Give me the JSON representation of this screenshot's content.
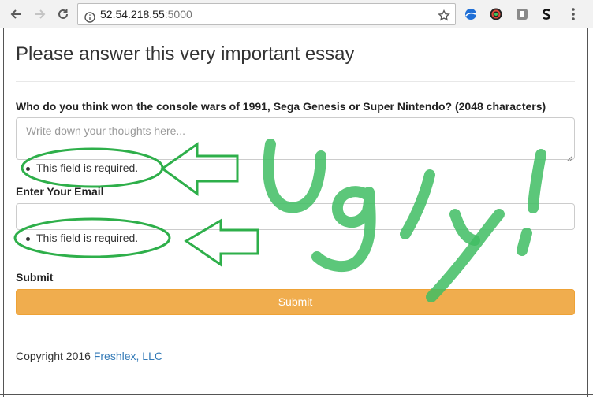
{
  "browser": {
    "url_host": "52.54.218.55",
    "url_port": ":5000",
    "icons": [
      "back-arrow-icon",
      "forward-arrow-icon",
      "reload-icon",
      "info-icon",
      "star-icon",
      "extension-icon",
      "extension-icon",
      "extension-icon",
      "extension-icon"
    ]
  },
  "page": {
    "title": "Please answer this very important essay",
    "question_label": "Who do you think won the console wars of 1991, Sega Genesis or Super Nintendo? (2048 characters)",
    "essay_placeholder": "Write down your thoughts here...",
    "essay_error": "This field is required.",
    "email_label": "Enter Your Email",
    "email_value": "",
    "email_error": "This field is required.",
    "submit_label": "Submit",
    "submit_button": "Submit",
    "footer_text": "Copyright 2016 ",
    "footer_link": "Freshlex, LLC"
  },
  "annotation": {
    "color": "#2eaf4a",
    "text": "Ugly!"
  }
}
